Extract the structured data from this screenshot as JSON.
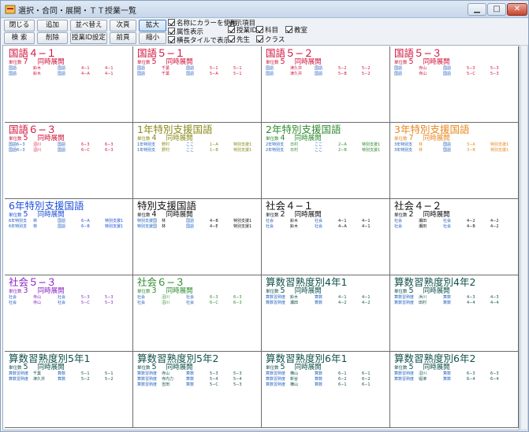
{
  "window": {
    "title": "選択・合同・展開・ＴＴ授業一覧"
  },
  "buttons": {
    "close": "閉じる",
    "add": "追加",
    "sort": "並べ替え",
    "next": "次頁",
    "zoom_in": "拡大",
    "search": "検 索",
    "delete": "削除",
    "class_id_settings": "授業ID設定",
    "prev": "前頁",
    "zoom_out": "縮小"
  },
  "options": {
    "color_names": "名称にカラーを使用",
    "attr_display": "属性表示",
    "horizontal_tile": "横長タイルで表示"
  },
  "display_items": {
    "heading": "表示項目",
    "class_id": "授業ID",
    "subject": "科目",
    "classroom": "教室",
    "teacher": "先生",
    "class": "クラス"
  },
  "labels": {
    "unit_count": "単位数"
  },
  "colors": {
    "red": "#d0143c",
    "olive": "#8a8a1a",
    "green": "#2f8a2f",
    "orange": "#e8871e",
    "blue": "#1f4fd8",
    "black": "#111111",
    "purple": "#8a22c6",
    "teal": "#10504a"
  },
  "cards": [
    {
      "title": "国語４−１",
      "color": "#d0143c",
      "units": "7",
      "type": "同時展開",
      "rows": [
        [
          "国語",
          "鈴木",
          "国語",
          "4−1",
          "4−1"
        ],
        [
          "国語",
          "鈴木",
          "国語",
          "4−A",
          "4−1"
        ]
      ]
    },
    {
      "title": "国語５−１",
      "color": "#d0143c",
      "units": "5",
      "type": "同時展開",
      "rows": [
        [
          "国語",
          "千葉",
          "国語",
          "5−1",
          "5−1"
        ],
        [
          "国語",
          "千葉",
          "国語",
          "5−A",
          "5−1"
        ]
      ]
    },
    {
      "title": "国語５−２",
      "color": "#d0143c",
      "units": "5",
      "type": "同時展開",
      "rows": [
        [
          "国語",
          "津久井",
          "国語",
          "5−2",
          "5−2"
        ],
        [
          "国語",
          "津久井",
          "国語",
          "5−B",
          "5−2"
        ]
      ]
    },
    {
      "title": "国語５−３",
      "color": "#d0143c",
      "units": "5",
      "type": "同時展開",
      "rows": [
        [
          "国語",
          "寺山",
          "国語",
          "5−3",
          "5−3"
        ],
        [
          "国語",
          "寺山",
          "国語",
          "5−C",
          "5−3"
        ]
      ]
    },
    {
      "title": "国語６−３",
      "color": "#d0143c",
      "units": "5",
      "type": "同時展開",
      "rows": [
        [
          "国語6−3",
          "沼川",
          "国語",
          "6−3",
          "6−3"
        ],
        [
          "国語6−3",
          "沼川",
          "国語",
          "6−C",
          "6−3"
        ]
      ]
    },
    {
      "title": "1年特別支援国語",
      "color": "#8a8a1a",
      "units": "4",
      "type": "同時展開",
      "rows": [
        [
          "1年特別支",
          "野村",
          "ここ",
          "1−A",
          "特別支援1"
        ],
        [
          "1年特別支",
          "野村",
          "ここ",
          "1−B",
          "特別支援1"
        ]
      ]
    },
    {
      "title": "2年特別支援国語",
      "color": "#2f8a2f",
      "units": "4",
      "type": "同時展開",
      "rows": [
        [
          "2年特別支",
          "日村",
          "ここ",
          "2−A",
          "特別支援1"
        ],
        [
          "2年特別支",
          "日村",
          "ここ",
          "2−B",
          "特別支援1"
        ]
      ]
    },
    {
      "title": "3年特別支援国語",
      "color": "#e8871e",
      "units": "7",
      "type": "同時展開",
      "rows": [
        [
          "3年特別支",
          "林",
          "国語",
          "3−A",
          "特別支援1"
        ],
        [
          "3年特別支",
          "林",
          "国語",
          "3−B",
          "特別支援1"
        ]
      ]
    },
    {
      "title": "6年特別支援国語",
      "color": "#1f4fd8",
      "units": "5",
      "type": "同時展開",
      "rows": [
        [
          "6年特別支",
          "林",
          "国語",
          "6−A",
          "特別支援1"
        ],
        [
          "6年特別支",
          "林",
          "国語",
          "6−B",
          "特別支援1"
        ]
      ]
    },
    {
      "title": "特別支援国語",
      "color": "#111111",
      "units": "4",
      "type": "同時展開",
      "rows": [
        [
          "特別支援国",
          "林",
          "国語",
          "4−B",
          "特別支援1"
        ],
        [
          "特別支援国",
          "林",
          "国語",
          "4−E",
          "特別支援1"
        ]
      ]
    },
    {
      "title": "社会４−１",
      "color": "#111111",
      "units": "2",
      "type": "同時展開",
      "rows": [
        [
          "社会",
          "鈴木",
          "社会",
          "4−1",
          "4−1"
        ],
        [
          "社会",
          "鈴木",
          "社会",
          "4−A",
          "4−1"
        ]
      ]
    },
    {
      "title": "社会４−２",
      "color": "#111111",
      "units": "2",
      "type": "同時展開",
      "rows": [
        [
          "社会",
          "瀬田",
          "社会",
          "4−2",
          "4−2"
        ],
        [
          "社会",
          "瀬田",
          "社会",
          "4−B",
          "4−2"
        ]
      ]
    },
    {
      "title": "社会５−３",
      "color": "#8a22c6",
      "units": "3",
      "type": "同時展開",
      "rows": [
        [
          "社会",
          "寺山",
          "社会",
          "5−3",
          "5−3"
        ],
        [
          "社会",
          "寺山",
          "社会",
          "5−C",
          "5−3"
        ]
      ]
    },
    {
      "title": "社会６−３",
      "color": "#2f8a2f",
      "units": "3",
      "type": "同時展開",
      "rows": [
        [
          "社会",
          "沼川",
          "社会",
          "6−3",
          "6−3"
        ],
        [
          "社会",
          "沼川",
          "社会",
          "6−C",
          "6−3"
        ]
      ]
    },
    {
      "title": "算数習熟度別4年1",
      "color": "#10504a",
      "units": "5",
      "type": "同時展開",
      "rows": [
        [
          "算数習熟度",
          "鈴木",
          "算数",
          "4−1",
          "4−1"
        ],
        [
          "算数習熟度",
          "瀬田",
          "算数",
          "4−2",
          "4−2"
        ]
      ]
    },
    {
      "title": "算数習熟度別4年2",
      "color": "#10504a",
      "units": "5",
      "type": "同時展開",
      "rows": [
        [
          "算数習熟度",
          "浜川",
          "算数",
          "4−3",
          "4−3"
        ],
        [
          "算数習熟度",
          "田村",
          "算数",
          "4−4",
          "4−4"
        ]
      ]
    },
    {
      "title": "算数習熟度別5年1",
      "color": "#10504a",
      "units": "5",
      "type": "同時展開",
      "rows": [
        [
          "算数習熟度",
          "千葉",
          "算数",
          "5−1",
          "5−1"
        ],
        [
          "算数習熟度",
          "津久井",
          "算数",
          "5−2",
          "5−2"
        ]
      ]
    },
    {
      "title": "算数習熟度別5年2",
      "color": "#10504a",
      "units": "5",
      "type": "同時展開",
      "rows": [
        [
          "算数習熟度",
          "寺山",
          "算数",
          "5−3",
          "5−3"
        ],
        [
          "算数習熟度",
          "寺内力",
          "算数",
          "5−4",
          "5−4"
        ],
        [
          "算数習熟度",
          "吉田",
          "算数",
          "5−C",
          "5−3"
        ]
      ]
    },
    {
      "title": "算数習熟度別6年1",
      "color": "#10504a",
      "units": "5",
      "type": "同時展開",
      "rows": [
        [
          "算数習熟度",
          "横山",
          "算数",
          "6−1",
          "6−1"
        ],
        [
          "算数習熟度",
          "新谷",
          "算数",
          "6−2",
          "6−2"
        ],
        [
          "算数習熟度",
          "横山",
          "算数",
          "6−1",
          "6−1"
        ]
      ]
    },
    {
      "title": "算数習熟度別6年2",
      "color": "#10504a",
      "units": "5",
      "type": "同時展開",
      "rows": [
        [
          "算数習熟度",
          "沼川",
          "算数",
          "6−3",
          "6−3"
        ],
        [
          "算数習熟度",
          "堀津",
          "算数",
          "6−4",
          "6−4"
        ]
      ]
    }
  ]
}
